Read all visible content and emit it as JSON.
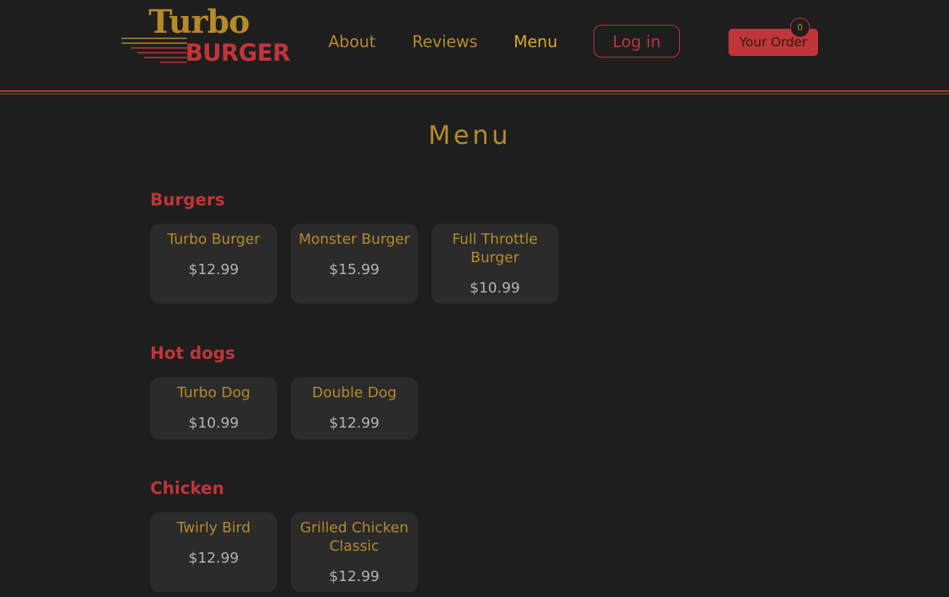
{
  "brand": {
    "name_top": "Turbo",
    "name_bottom": "BURGER"
  },
  "nav": {
    "about": "About",
    "reviews": "Reviews",
    "menu": "Menu",
    "login": "Log in",
    "order": "Your Order",
    "order_count": "0"
  },
  "page": {
    "title": "Menu"
  },
  "sections": [
    {
      "title": "Burgers",
      "items": [
        {
          "name": "Turbo Burger",
          "price": "$12.99"
        },
        {
          "name": "Monster Burger",
          "price": "$15.99"
        },
        {
          "name": "Full Throttle Burger",
          "price": "$10.99"
        }
      ]
    },
    {
      "title": "Hot dogs",
      "items": [
        {
          "name": "Turbo Dog",
          "price": "$10.99"
        },
        {
          "name": "Double Dog",
          "price": "$12.99"
        }
      ]
    },
    {
      "title": "Chicken",
      "items": [
        {
          "name": "Twirly Bird",
          "price": "$12.99"
        },
        {
          "name": "Grilled Chicken Classic",
          "price": "$12.99"
        }
      ]
    }
  ],
  "colors": {
    "background": "#1e1e1e",
    "card": "#2b2b2b",
    "gold": "#b58a2a",
    "red": "#c0353a",
    "price": "#b3b3b3"
  }
}
